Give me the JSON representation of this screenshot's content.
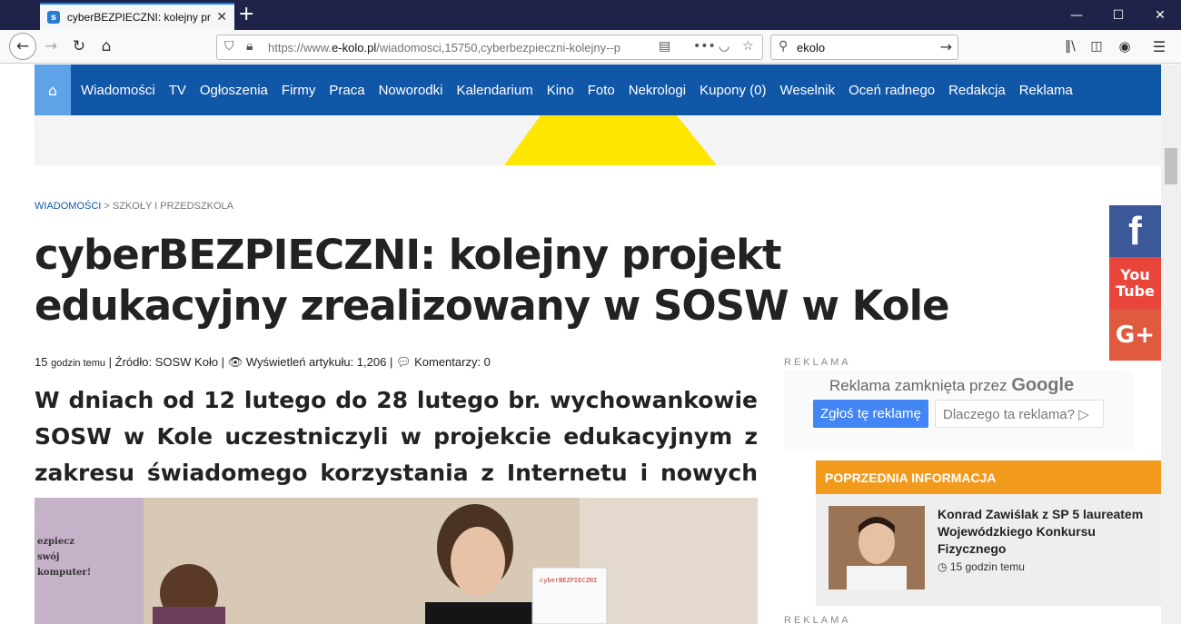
{
  "browser": {
    "tab_title": "cyberBEZPIECZNI: kolejny proje",
    "favicon_letter": "s",
    "url_prefix": "https://www.",
    "url_domain": "e-kolo.pl",
    "url_rest": "/wiadomosci,15750,cyberbezpieczni-kolejny--p",
    "search_value": "ekolo"
  },
  "nav": {
    "items": [
      "Wiadomości",
      "TV",
      "Ogłoszenia",
      "Firmy",
      "Praca",
      "Noworodki",
      "Kalendarium",
      "Kino",
      "Foto",
      "Nekrologi",
      "Kupony (0)",
      "Weselnik",
      "Oceń radnego",
      "Redakcja",
      "Reklama"
    ]
  },
  "breadcrumb": {
    "section": "WIADOMOŚCI",
    "separator": " > ",
    "subsection": "SZKOŁY I PRZEDSZKOLA"
  },
  "article": {
    "title": "cyberBEZPIECZNI: kolejny projekt edukacyjny zrealizowany w SOSW w Kole",
    "meta_num": "15",
    "meta_time": "godzin temu",
    "meta_source": "| Źródło: SOSW Koło |",
    "meta_views": "Wyświetleń artykułu: 1,206 |",
    "meta_comments": "Komentarzy: 0",
    "lead": "W dniach od 12 lutego do 28 lutego br. wychowankowie SOSW w Kole uczestniczyli w projekcie edukacyjnym z zakresu świadomego korzystania z Internetu i nowych technologii.",
    "photo_text": "ezpiecz swój komputer!",
    "photo_card": "cyberBEZPIECZNI"
  },
  "social": {
    "facebook": "f",
    "youtube_1": "You",
    "youtube_2": "Tube",
    "googleplus": "G+"
  },
  "ad": {
    "label": "REKLAMA",
    "closed_text": "Reklama zamknięta przez",
    "closed_brand": "Google",
    "report_button": "Zgłoś tę reklamę",
    "why_button": "Dlaczego ta reklama? ▷"
  },
  "previous": {
    "header": "POPRZEDNIA INFORMACJA",
    "title": "Konrad Zawiślak z SP 5 laureatem Wojewódzkiego Konkursu Fizycznego",
    "time": "15 godzin temu"
  },
  "ad2": {
    "label": "REKLAMA"
  },
  "colors": {
    "nav_bg": "#1157a8",
    "nav_home": "#5ea3e8",
    "prev_header": "#f29a1b",
    "banner_yellow": "#ffe600"
  }
}
